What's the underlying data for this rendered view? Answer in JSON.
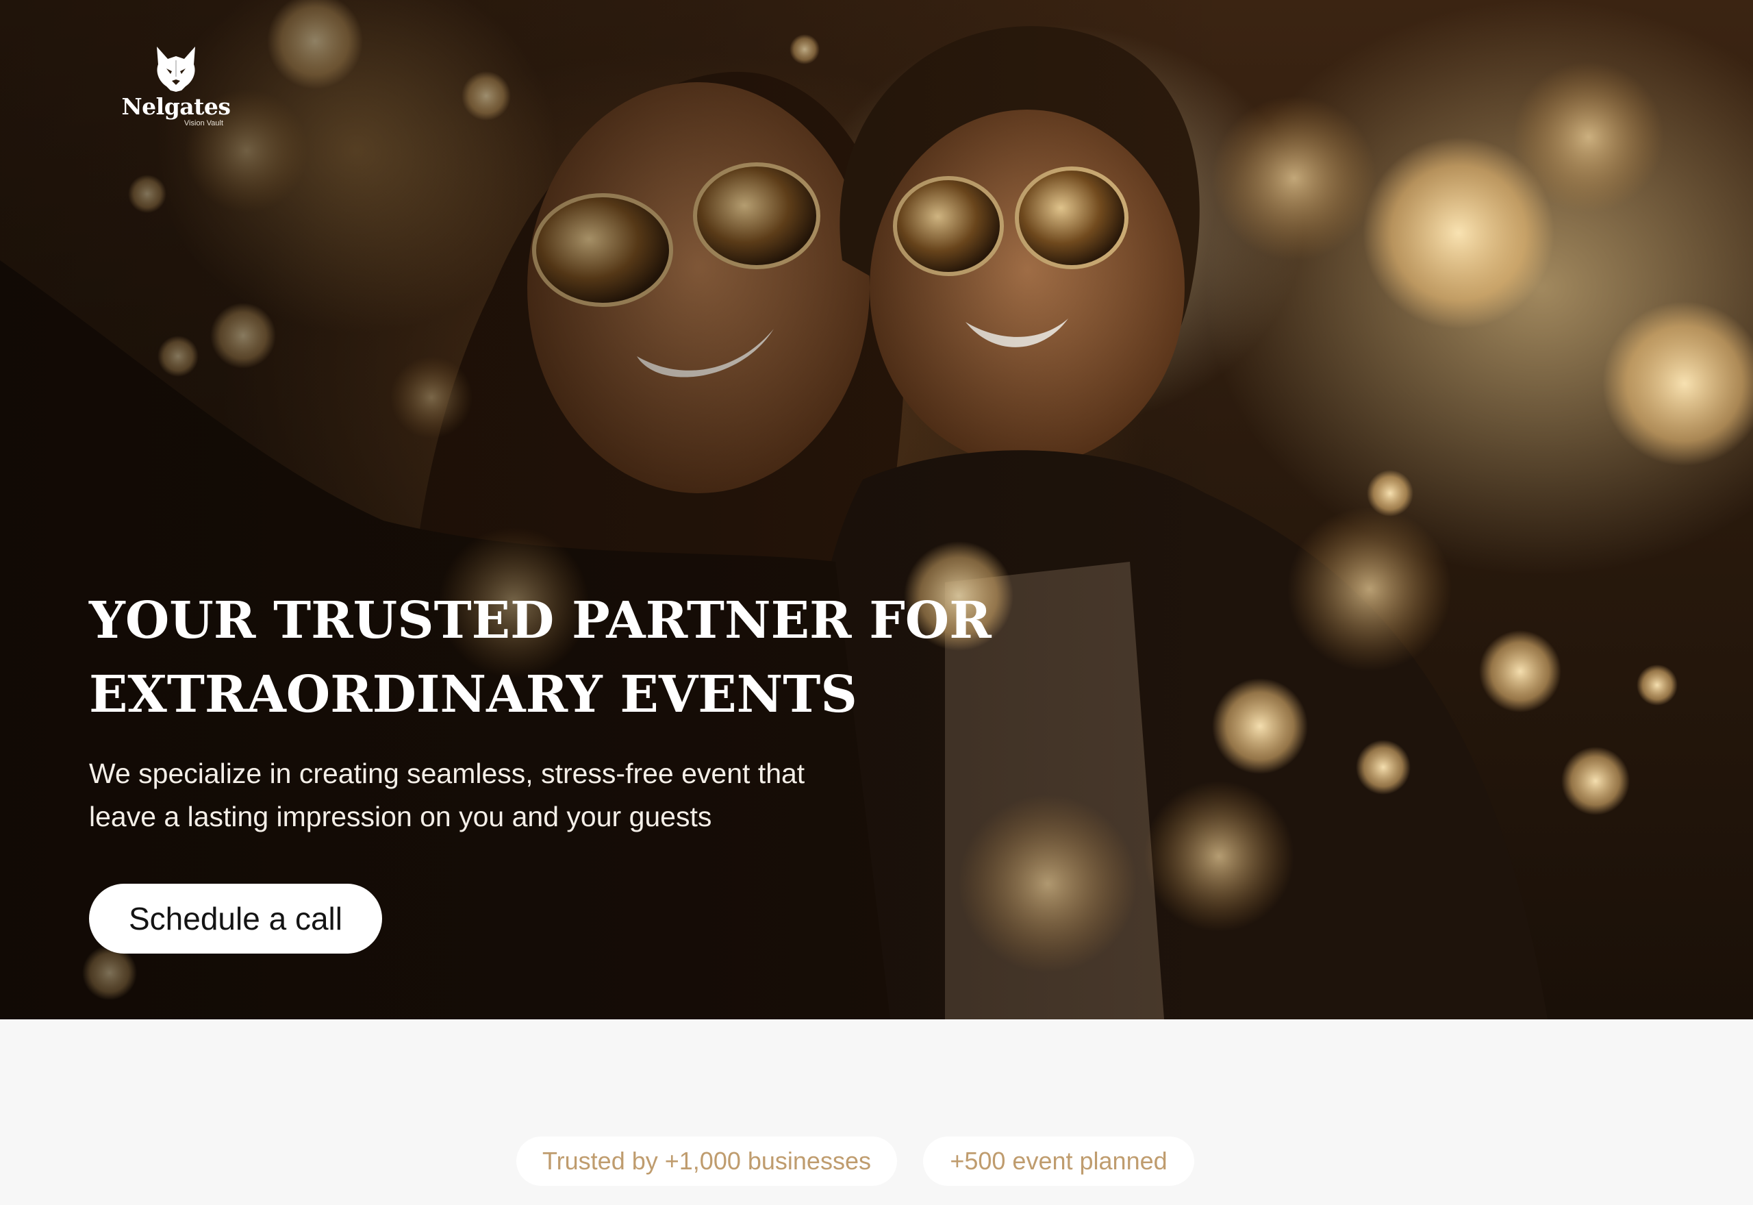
{
  "brand": {
    "name": "Nelgates",
    "tagline": "Vision Vault",
    "logo_icon": "wolf-head-icon"
  },
  "hero": {
    "headline_line1": "YOUR TRUSTED PARTNER FOR",
    "headline_line2": "EXTRAORDINARY EVENTS",
    "subheading_line1": "We specialize in creating seamless, stress-free event that",
    "subheading_line2": "leave a lasting impression on you and your guests",
    "cta_label": "Schedule a call"
  },
  "stats": [
    {
      "label": "Trusted by +1,000 businesses"
    },
    {
      "label": "+500 event planned"
    }
  ],
  "colors": {
    "accent_text": "#bf9c6e",
    "page_background": "#f7f7f7",
    "cta_background": "#ffffff"
  }
}
